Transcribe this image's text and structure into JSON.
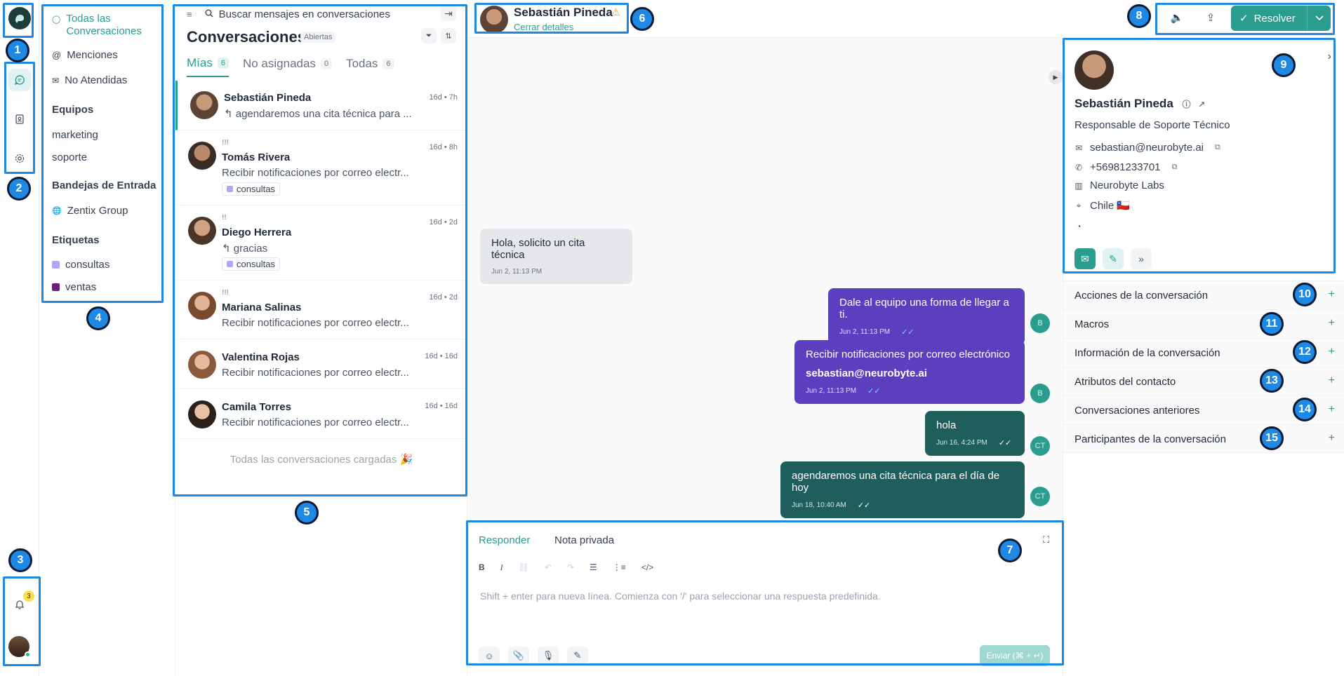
{
  "sidebar": {
    "items": [
      {
        "label": "Todas las Conversaciones",
        "active": true
      },
      {
        "label": "Menciones"
      },
      {
        "label": "No Atendidas"
      }
    ],
    "teams_heading": "Equipos",
    "teams": [
      "marketing",
      "soporte"
    ],
    "inboxes_heading": "Bandejas de Entrada",
    "inboxes": [
      "Zentix Group"
    ],
    "labels_heading": "Etiquetas",
    "labels": [
      {
        "label": "consultas",
        "color": "#b6a3f5"
      },
      {
        "label": "ventas",
        "color": "#6b1f7a"
      }
    ],
    "notification_count": "3"
  },
  "list": {
    "search_placeholder": "Buscar mensajes en conversaciones",
    "title": "Conversaciones",
    "status": "Abiertas",
    "tabs": [
      {
        "label": "Mías",
        "count": "6",
        "active": true
      },
      {
        "label": "No asignadas",
        "count": "0"
      },
      {
        "label": "Todas",
        "count": "6"
      }
    ],
    "conversations": [
      {
        "name": "Sebastián Pineda",
        "time": "16d • 7h",
        "message": "↰ agendaremos una cita técnica para ...",
        "priority": "",
        "tag": ""
      },
      {
        "name": "Tomás Rivera",
        "time": "16d • 8h",
        "message": "Recibir notificaciones por correo electr...",
        "priority": "!!!",
        "tag": "consultas"
      },
      {
        "name": "Diego Herrera",
        "time": "16d • 2d",
        "message": "↰ gracias",
        "priority": "!!",
        "tag": "consultas"
      },
      {
        "name": "Mariana Salinas",
        "time": "16d • 2d",
        "message": "Recibir notificaciones por correo electr...",
        "priority": "!!!",
        "tag": ""
      },
      {
        "name": "Valentina Rojas",
        "time": "16d • 16d",
        "message": "Recibir notificaciones por correo electr...",
        "priority": "",
        "tag": ""
      },
      {
        "name": "Camila Torres",
        "time": "16d • 16d",
        "message": "Recibir notificaciones por correo electr...",
        "priority": "",
        "tag": ""
      }
    ],
    "loaded_text": "Todas las conversaciones cargadas 🎉"
  },
  "chat": {
    "contact_name": "Sebastián Pineda",
    "close_details": "Cerrar detalles",
    "messages": [
      {
        "text": "Hola, solicito un cita técnica",
        "time": "Jun 2, 11:13 PM",
        "direction": "in"
      },
      {
        "text": "Dale al equipo una forma de llegar a ti.",
        "time": "Jun 2, 11:13 PM",
        "direction": "out",
        "avatar": "B"
      },
      {
        "text": "Recibir notificaciones por correo electrónico",
        "bold": "sebastian@neurobyte.ai",
        "time": "Jun 2, 11:13 PM",
        "direction": "out",
        "avatar": "B"
      },
      {
        "text": "hola",
        "time": "Jun 16, 4:24 PM",
        "direction": "out",
        "avatar": "CT"
      },
      {
        "text": "agendaremos una cita técnica para el día de hoy",
        "time": "Jun 18, 10:40 AM",
        "direction": "out",
        "avatar": "CT"
      }
    ]
  },
  "composer": {
    "tab_reply": "Responder",
    "tab_note": "Nota privada",
    "placeholder": "Shift + enter para nueva línea. Comienza con '/' para seleccionar una respuesta predefinida.",
    "send_label": "Enviar (⌘ + ↵)"
  },
  "actions": {
    "resolve_label": "Resolver"
  },
  "contact": {
    "name": "Sebastián Pineda",
    "role": "Responsable de Soporte Técnico",
    "email": "sebastian@neurobyte.ai",
    "phone": "+56981233701",
    "company": "Neurobyte Labs",
    "location": "Chile 🇨🇱",
    "sections": [
      "Acciones de la conversación",
      "Macros",
      "Información de la conversación",
      "Atributos del contacto",
      "Conversaciones anteriores",
      "Participantes de la conversación"
    ]
  },
  "callouts": [
    "1",
    "2",
    "3",
    "4",
    "5",
    "6",
    "7",
    "8",
    "9",
    "10",
    "11",
    "12",
    "13",
    "14",
    "15"
  ]
}
